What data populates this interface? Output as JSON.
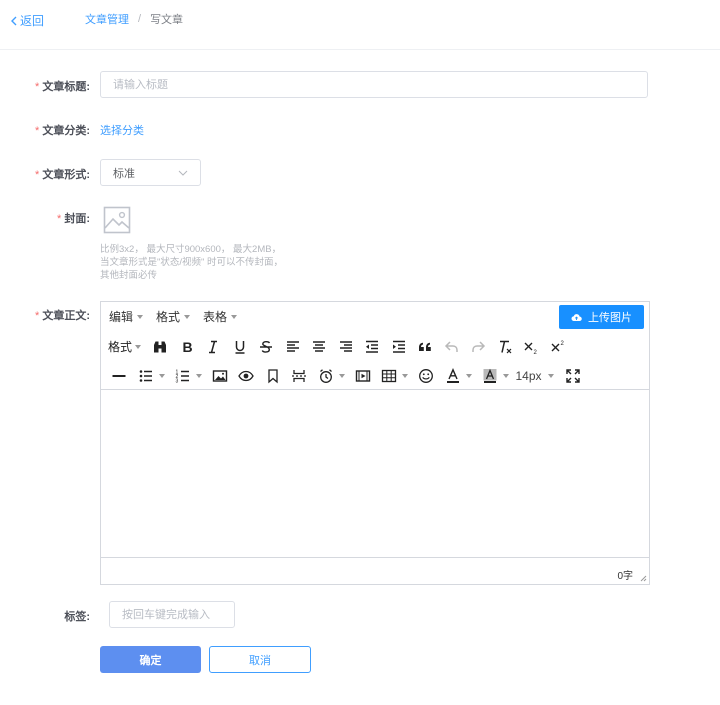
{
  "header": {
    "back_label": "返回",
    "breadcrumb": {
      "parent": "文章管理",
      "separator": "/",
      "current": "写文章"
    }
  },
  "form": {
    "title_label": "文章标题:",
    "title_placeholder": "请输入标题",
    "category_label": "文章分类:",
    "category_link": "选择分类",
    "format_label": "文章形式:",
    "format_value": "标准",
    "cover_label": "封面:",
    "cover_hint": [
      "比例3x2， 最大尺寸900x600， 最大2MB，",
      "当文章形式是\"状态/视频\" 时可以不传封面，",
      "其他封面必传"
    ],
    "body_label": "文章正文:",
    "tags_label": "标签:",
    "tags_placeholder": "按回车键完成输入",
    "required_mark": "*"
  },
  "editor": {
    "menus": [
      "编辑",
      "格式",
      "表格"
    ],
    "upload_button": "上传图片",
    "formats_label": "格式",
    "font_size": "14px",
    "word_count": "0字"
  },
  "actions": {
    "confirm": "确定",
    "cancel": "取消"
  },
  "colors": {
    "accent": "#409eff",
    "primary_button": "#5d8ff0",
    "upload_button": "#1890ff",
    "required": "#f56c6c"
  }
}
